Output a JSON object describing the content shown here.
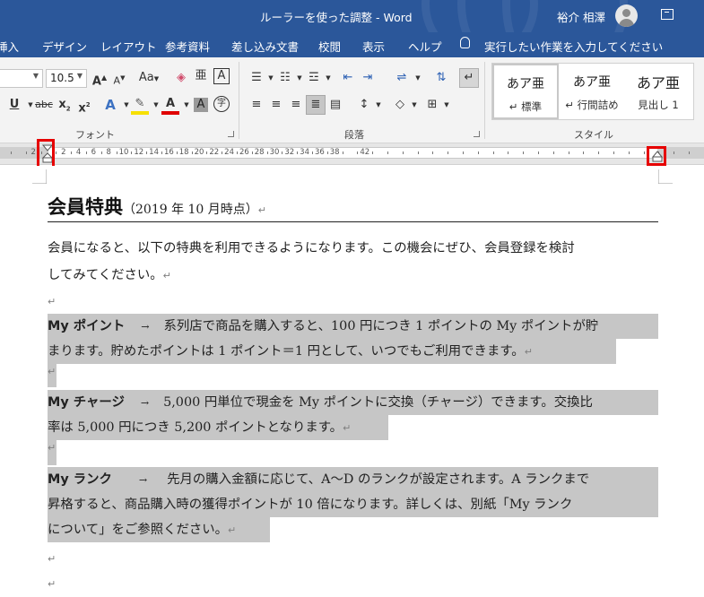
{
  "titlebar": {
    "document_title": "ルーラーを使った調整  -  Word",
    "user_name": "裕介 相澤"
  },
  "ribbon_tabs": [
    "挿入",
    "デザイン",
    "レイアウト",
    "参考資料",
    "差し込み文書",
    "校閲",
    "表示",
    "ヘルプ"
  ],
  "tell_me": "実行したい作業を入力してください",
  "font_group": {
    "label": "フォント",
    "font_size": "10.5",
    "grow": "A",
    "shrink": "A",
    "change_case": "Aa",
    "underline": "U",
    "strikethrough": "abc",
    "subscript": "x",
    "superscript": "x",
    "text_effects": "A",
    "font_color": "A",
    "char_shading": "A",
    "enclose": "字",
    "phonetic": "亜",
    "border_char": "A"
  },
  "paragraph_group": {
    "label": "段落"
  },
  "styles_group": {
    "label": "スタイル",
    "items": [
      {
        "sample": "あア亜",
        "name": "↵ 標準"
      },
      {
        "sample": "あア亜",
        "name": "↵ 行間詰め"
      },
      {
        "sample": "あア亜",
        "name": "見出し 1"
      }
    ]
  },
  "ruler": {
    "numbers": [
      "2",
      "2",
      "4",
      "6",
      "8",
      "10",
      "12",
      "14",
      "16",
      "18",
      "20",
      "22",
      "24",
      "26",
      "28",
      "30",
      "32",
      "34",
      "36",
      "38",
      "42"
    ]
  },
  "document": {
    "heading_main": "会員特典",
    "heading_sub": "（2019 年 10 月時点）",
    "intro_line1": "会員になると、以下の特典を利用できるようになります。この機会にぜひ、会員登録を検討",
    "intro_line2": "してみてください。",
    "p1_term": "My ポイント",
    "p1_arrow": "→",
    "p1_line1": "系列店で商品を購入すると、100 円につき 1 ポイントの My ポイントが貯",
    "p1_line2": "まります。貯めたポイントは 1 ポイント＝1 円として、いつでもご利用できます。",
    "p2_term": "My チャージ",
    "p2_arrow": "→",
    "p2_line1": "5,000 円単位で現金を My ポイントに交換（チャージ）できます。交換比",
    "p2_line2": "率は 5,000 円につき 5,200 ポイントとなります。",
    "p3_term": "My ランク",
    "p3_arrow": "→",
    "p3_line1": "先月の購入金額に応じて、A～D のランクが設定されます。A ランクまで",
    "p3_line2": "昇格すると、商品購入時の獲得ポイントが 10 倍になります。詳しくは、別紙「My ランク",
    "p3_line3": "について」をご参照ください。",
    "para_mark": "↵"
  },
  "colors": {
    "word_blue": "#2b579a",
    "highlight_red": "#e60000",
    "selection_gray": "#c6c6c6"
  }
}
